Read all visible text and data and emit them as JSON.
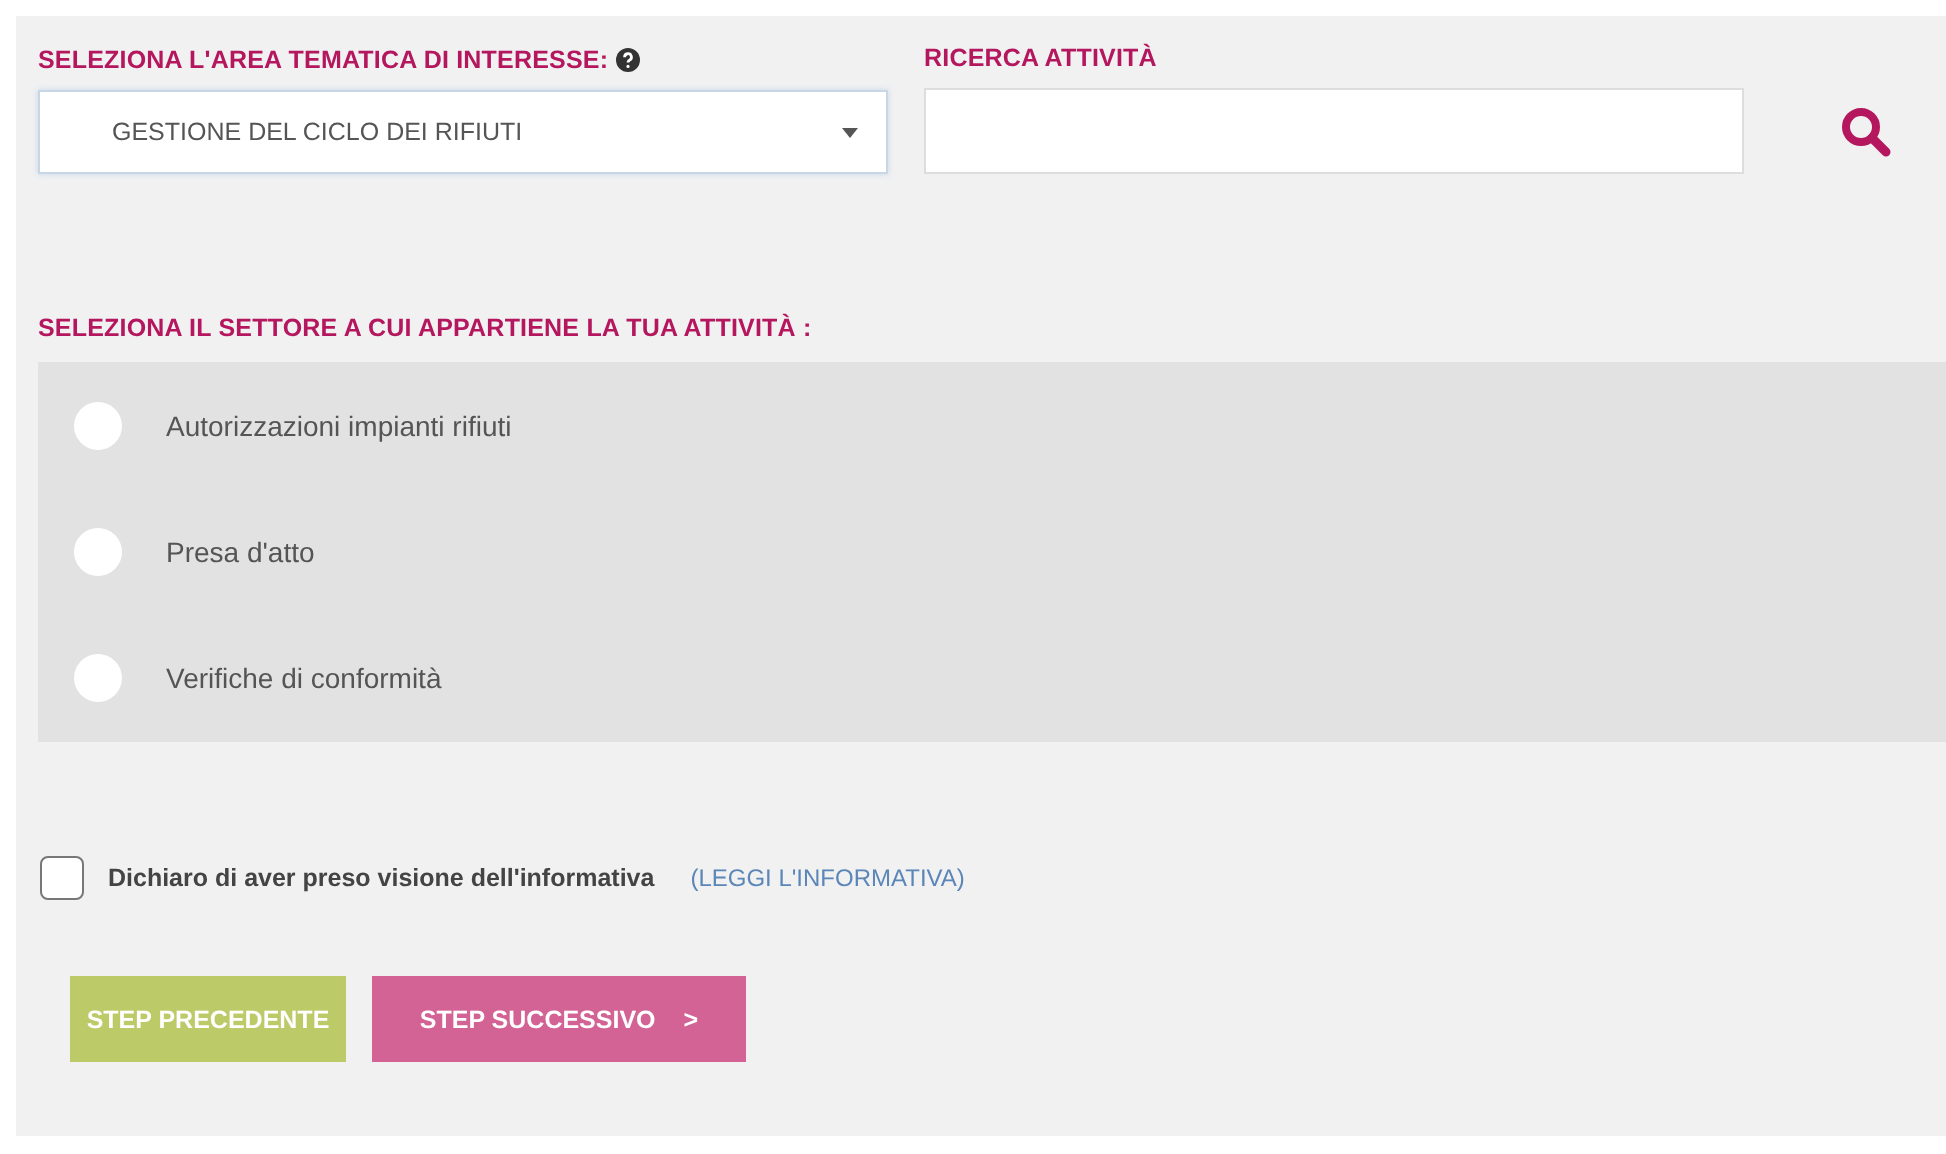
{
  "area_field": {
    "label": "SELEZIONA L'AREA TEMATICA DI INTERESSE:",
    "value": "GESTIONE DEL CICLO DEI RIFIUTI"
  },
  "search": {
    "label": "RICERCA ATTIVITÀ"
  },
  "sector": {
    "label": "SELEZIONA IL SETTORE A CUI APPARTIENE LA TUA ATTIVITÀ :",
    "options": [
      {
        "label": "Autorizzazioni impianti rifiuti",
        "selected": false
      },
      {
        "label": "Presa d'atto",
        "selected": false
      },
      {
        "label": "Verifiche di conformità",
        "selected": false
      }
    ]
  },
  "consent": {
    "label": "Dichiaro di aver preso visione dell'informativa",
    "checked": false,
    "link": "(LEGGI L'INFORMATIVA)"
  },
  "buttons": [
    {
      "label": "STEP PRECEDENTE",
      "kind": "back"
    },
    {
      "label": "STEP SUCCESSIVO",
      "kind": "next",
      "arrow": ">"
    }
  ]
}
